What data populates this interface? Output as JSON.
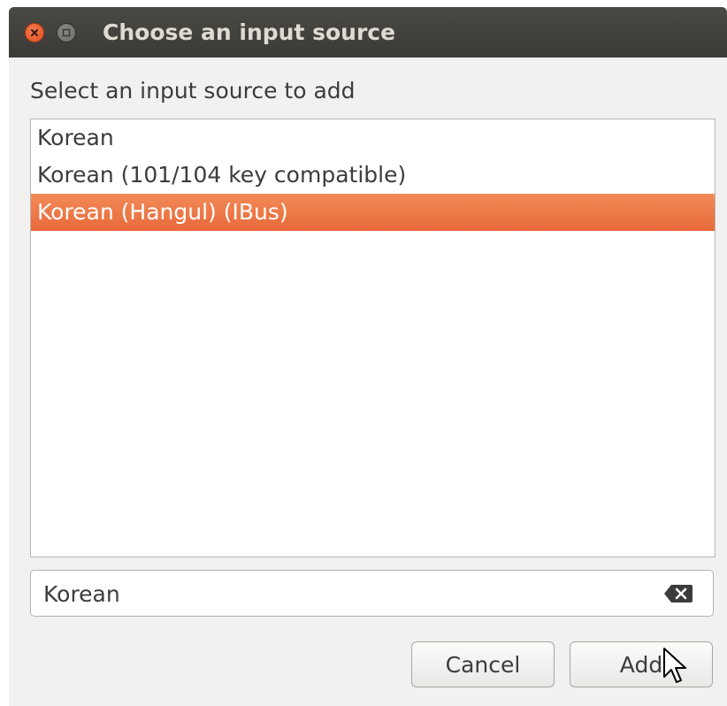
{
  "window": {
    "title": "Choose an input source"
  },
  "dialog": {
    "prompt": "Select an input source to add",
    "list": [
      {
        "label": "Korean",
        "selected": false
      },
      {
        "label": "Korean (101/104 key compatible)",
        "selected": false
      },
      {
        "label": "Korean (Hangul) (IBus)",
        "selected": true
      }
    ],
    "search_value": "Korean",
    "cancel_label": "Cancel",
    "add_label": "Add"
  },
  "icons": {
    "close": "close-icon",
    "maximize": "maximize-icon",
    "clear": "clear-text-icon",
    "cursor": "mouse-pointer-icon"
  },
  "colors": {
    "selection": "#ec7440",
    "titlebar": "#42413d",
    "window_bg": "#f2f1f0"
  }
}
